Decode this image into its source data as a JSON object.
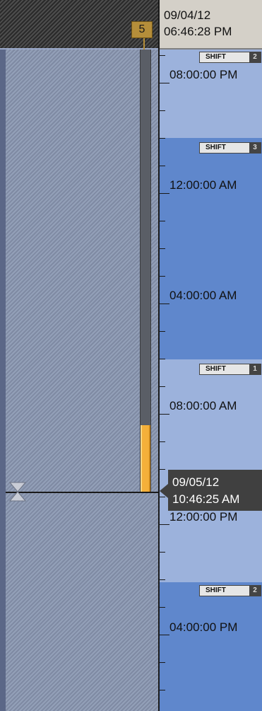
{
  "header": {
    "marker_count": "5",
    "start_date": "09/04/12",
    "start_time": "06:46:28 PM"
  },
  "progress": {
    "fill_fraction": 0.15
  },
  "shifts": [
    {
      "label": "SHIFT",
      "number": "2"
    },
    {
      "label": "SHIFT",
      "number": "3"
    },
    {
      "label": "SHIFT",
      "number": "1"
    },
    {
      "label": "SHIFT",
      "number": "2"
    }
  ],
  "time_labels": [
    "08:00:00 PM",
    "12:00:00 AM",
    "04:00:00 AM",
    "08:00:00 AM",
    "12:00:00 PM",
    "04:00:00 PM"
  ],
  "current": {
    "date": "09/05/12",
    "time": "10:46:25 AM"
  },
  "colors": {
    "shift_light": "#9cb2dc",
    "shift_dark": "#5f87cc",
    "progress": "#f4b03a",
    "callout": "#404040"
  }
}
